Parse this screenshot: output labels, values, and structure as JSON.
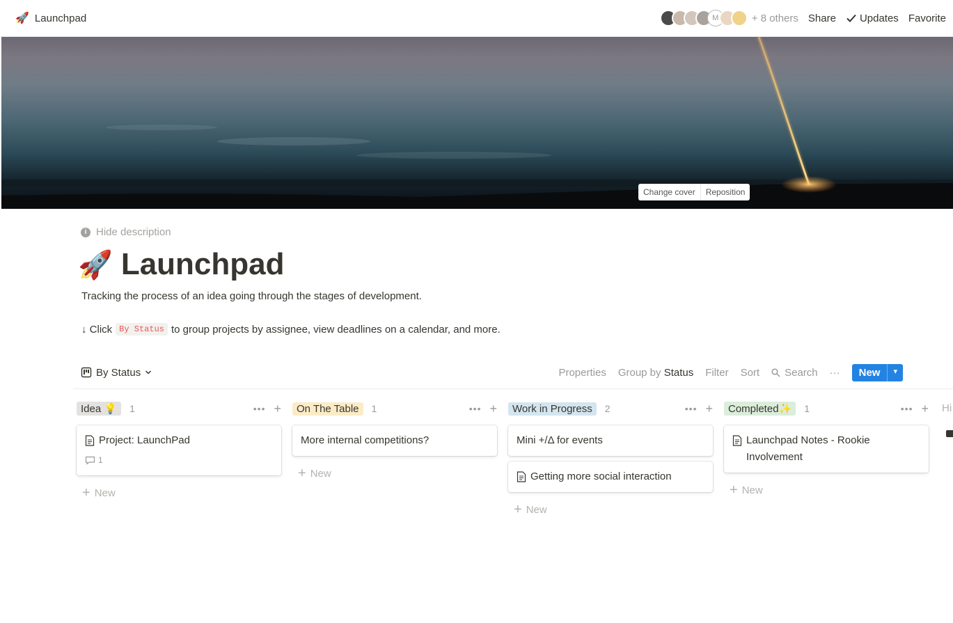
{
  "topbar": {
    "page_icon": "rocket-icon",
    "breadcrumb": "Launchpad",
    "others": "+ 8 others",
    "share": "Share",
    "updates": "Updates",
    "favorite": "Favorite",
    "avatar_letter": "M"
  },
  "cover": {
    "change_cover": "Change cover",
    "reposition": "Reposition"
  },
  "page": {
    "hide_description": "Hide description",
    "title": "Launchpad",
    "description": "Tracking the process of an idea going through the stages of development.",
    "hint_prefix": "↓ Click",
    "hint_code": "By Status",
    "hint_suffix": "to group projects by assignee, view deadlines on a calendar, and more."
  },
  "view": {
    "name": "By Status",
    "properties": "Properties",
    "group_by": "Group by",
    "group_by_value": "Status",
    "filter": "Filter",
    "sort": "Sort",
    "search": "Search",
    "more": "···",
    "new": "New"
  },
  "board": {
    "new_label": "New",
    "hidden_label": "Hi",
    "columns": [
      {
        "name": "Idea",
        "emoji": "💡",
        "count": "1",
        "tag_color": "#e3e2e0",
        "cards": [
          {
            "title": "Project: LaunchPad",
            "doc": true,
            "comments": "1"
          }
        ]
      },
      {
        "name": "On The Table",
        "emoji": "",
        "count": "1",
        "tag_color": "#fbecc7",
        "cards": [
          {
            "title": "More internal competitions?",
            "doc": false
          }
        ]
      },
      {
        "name": "Work in Progress",
        "emoji": "",
        "count": "2",
        "tag_color": "#d3e5ef",
        "cards": [
          {
            "title": "Mini +/Δ for events",
            "doc": false
          },
          {
            "title": "Getting more social interaction",
            "doc": true
          }
        ]
      },
      {
        "name": "Completed",
        "emoji": "✨",
        "count": "1",
        "tag_color": "#dbeddb",
        "cards": [
          {
            "title": "Launchpad Notes - Rookie Involvement",
            "doc": true
          }
        ]
      }
    ]
  },
  "colors": {
    "accent": "#2383e2",
    "text": "#37352f",
    "muted": "#9b9a97"
  }
}
